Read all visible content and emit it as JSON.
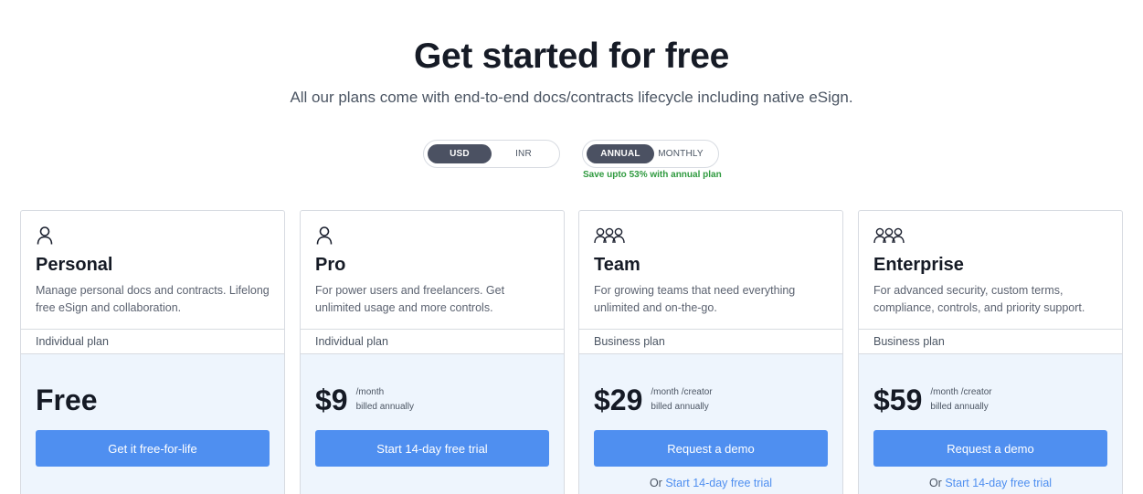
{
  "hero": {
    "title": "Get started for free",
    "subtitle": "All our plans come with end-to-end docs/contracts lifecycle including native eSign."
  },
  "currency_toggle": {
    "options": [
      "USD",
      "INR"
    ],
    "selected": "USD"
  },
  "billing_toggle": {
    "options": [
      "ANNUAL",
      "MONTHLY"
    ],
    "selected": "ANNUAL"
  },
  "save_note": "Save upto 53% with annual plan",
  "colors": {
    "accent": "#4f8ff0",
    "toggle_active": "#4b5162",
    "save_green": "#2f9a3f",
    "card_bottom_bg": "#eef5fd"
  },
  "plans": [
    {
      "icon": "user-icon",
      "name": "Personal",
      "description": "Manage personal docs and contracts. Lifelong free eSign and collaboration.",
      "type": "Individual plan",
      "price": "Free",
      "price_period": "",
      "price_note": "",
      "cta": "Get it free-for-life",
      "alt_prefix": "",
      "alt_link": ""
    },
    {
      "icon": "user-icon",
      "name": "Pro",
      "description": "For power users and freelancers. Get unlimited usage and more controls.",
      "type": "Individual plan",
      "price": "$9",
      "price_period": "/month",
      "price_note": "billed annually",
      "cta": "Start 14-day free trial",
      "alt_prefix": "",
      "alt_link": ""
    },
    {
      "icon": "team-icon",
      "name": "Team",
      "description": "For growing teams that need everything unlimited and on-the-go.",
      "type": "Business plan",
      "price": "$29",
      "price_period": "/month /creator",
      "price_note": "billed annually",
      "cta": "Request a demo",
      "alt_prefix": "Or",
      "alt_link": "Start 14-day free trial"
    },
    {
      "icon": "team-icon",
      "name": "Enterprise",
      "description": "For advanced security, custom terms, compliance, controls, and priority support.",
      "type": "Business plan",
      "price": "$59",
      "price_period": "/month /creator",
      "price_note": "billed annually",
      "cta": "Request a demo",
      "alt_prefix": "Or",
      "alt_link": "Start 14-day free trial"
    }
  ]
}
